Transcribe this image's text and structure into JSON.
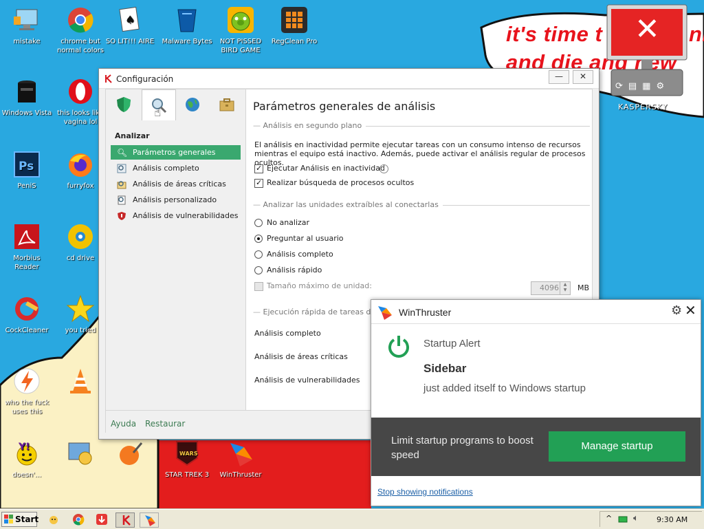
{
  "wallpaper": {
    "line1": "it's time t",
    "line1b": "nit",
    "line2": "and die and new",
    "gadget_brand": "KASPERSKY"
  },
  "desktop_icons": [
    {
      "label": "mistake"
    },
    {
      "label": "chrome but normal colors"
    },
    {
      "label": "SO LIT!!! AIRE"
    },
    {
      "label": "Malware Bytes"
    },
    {
      "label": "NOT PISSED BIRD GAME"
    },
    {
      "label": "RegClean Pro"
    },
    {
      "label": "Windows Vista"
    },
    {
      "label": "this looks like vagina lol"
    },
    {
      "label": "PeniS"
    },
    {
      "label": "furryfox"
    },
    {
      "label": "Morbius Reader"
    },
    {
      "label": "cd drive"
    },
    {
      "label": "CockCleaner"
    },
    {
      "label": "you tried"
    },
    {
      "label": "who the fuck uses this"
    },
    {
      "label": "doesn'..."
    },
    {
      "label": "STAR TREK 3"
    },
    {
      "label": "WinThruster"
    }
  ],
  "kaspersky": {
    "window_title": "Configuración",
    "nav_title": "Analizar",
    "nav_items": [
      {
        "label": "Parámetros generales",
        "selected": true
      },
      {
        "label": "Análisis completo"
      },
      {
        "label": "Análisis de áreas críticas"
      },
      {
        "label": "Análisis personalizado"
      },
      {
        "label": "Análisis de vulnerabilidades"
      }
    ],
    "page_title": "Parámetros generales de análisis",
    "section1": "Análisis en segundo plano",
    "section1_desc": "El análisis en inactividad permite ejecutar tareas con un consumo intenso de recursos mientras el equipo está inactivo. Además, puede activar el análisis regular de procesos ocultos.",
    "check1": {
      "label": "Ejecutar Análisis en inactividad",
      "checked": true
    },
    "check2": {
      "label": "Realizar búsqueda de procesos ocultos",
      "checked": true
    },
    "section2": "Analizar las unidades extraíbles al conectarlas",
    "radios": [
      {
        "label": "No analizar",
        "selected": false
      },
      {
        "label": "Preguntar al usuario",
        "selected": true
      },
      {
        "label": "Análisis completo",
        "selected": false
      },
      {
        "label": "Análisis rápido",
        "selected": false
      }
    ],
    "max_size_label": "Tamaño máximo de unidad:",
    "max_size_value": "4096",
    "max_size_unit": "MB",
    "section3": "Ejecución rápida de tareas de a",
    "tasks": [
      "Análisis completo",
      "Análisis de áreas críticas",
      "Análisis de vulnerabilidades"
    ],
    "footer_help": "Ayuda",
    "footer_restore": "Restaurar",
    "min_label": "—",
    "close_label": "✕"
  },
  "winthruster": {
    "title": "WinThruster",
    "alert_title": "Startup Alert",
    "app_name": "Sidebar",
    "message": "just added itself to Windows startup",
    "band_text": "Limit startup programs to boost speed",
    "button": "Manage startup",
    "stop_link": "Stop showing notifications",
    "accent": "#22a055"
  },
  "taskbar": {
    "start_label": "Start",
    "clock": "9:30 AM",
    "tray_chevron": "^"
  }
}
